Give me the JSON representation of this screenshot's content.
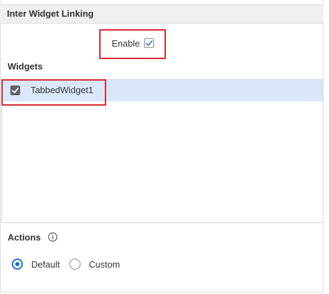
{
  "panel": {
    "title": "Inter Widget Linking"
  },
  "enable": {
    "label": "Enable",
    "checked": true
  },
  "widgets": {
    "label": "Widgets",
    "items": [
      {
        "label": "TabbedWidget1",
        "checked": true,
        "selected": true
      }
    ]
  },
  "actions": {
    "label": "Actions",
    "info_icon": "info-icon",
    "options": [
      {
        "label": "Default",
        "selected": true
      },
      {
        "label": "Custom",
        "selected": false
      }
    ]
  },
  "colors": {
    "accent": "#1a73c8",
    "highlight": "#d9272e",
    "row_selected": "#d9e7f8"
  }
}
